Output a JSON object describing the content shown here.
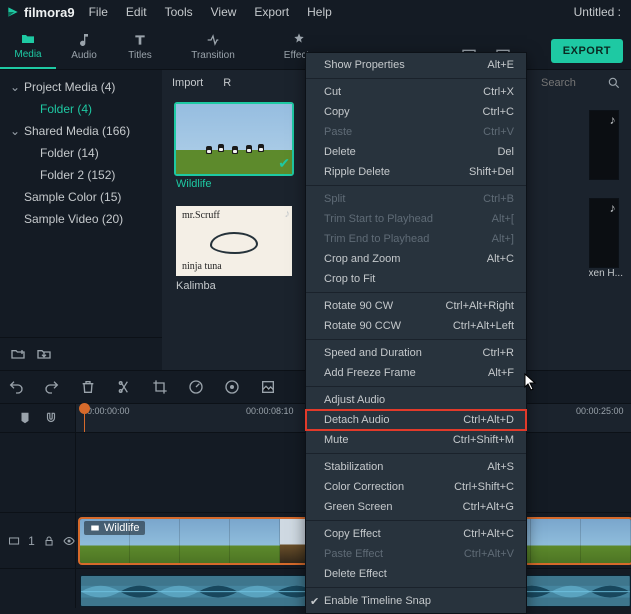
{
  "app": {
    "name": "filmora9",
    "window_title": "Untitled :"
  },
  "menubar": [
    "File",
    "Edit",
    "Tools",
    "View",
    "Export",
    "Help"
  ],
  "tabs": {
    "media": "Media",
    "audio": "Audio",
    "titles": "Titles",
    "transition": "Transition",
    "effects": "Effects"
  },
  "export_btn": "EXPORT",
  "content_header": {
    "import": "Import",
    "record_short": "R",
    "search_placeholder": "Search"
  },
  "sidebar": {
    "items": [
      {
        "label": "Project Media (4)",
        "indent": 0,
        "expandable": true,
        "selected": false
      },
      {
        "label": "Folder (4)",
        "indent": 1,
        "expandable": false,
        "selected": true
      },
      {
        "label": "Shared Media (166)",
        "indent": 0,
        "expandable": true,
        "selected": false
      },
      {
        "label": "Folder (14)",
        "indent": 1,
        "expandable": false,
        "selected": false
      },
      {
        "label": "Folder 2 (152)",
        "indent": 1,
        "expandable": false,
        "selected": false
      },
      {
        "label": "Sample Color (15)",
        "indent": 0,
        "expandable": false,
        "selected": false
      },
      {
        "label": "Sample Video (20)",
        "indent": 0,
        "expandable": false,
        "selected": false
      }
    ]
  },
  "thumbs": {
    "wildlife": "Wildlife",
    "kalimba": "Kalimba",
    "scruff_top": "mr.Scruff",
    "scruff_bot": "ninja tuna",
    "right1": "xen H..."
  },
  "timeline": {
    "timecodes": [
      "00:00:00:00",
      "00:00:08:10",
      "00:00:25:00"
    ],
    "clip_label": "Wildlife",
    "track_label": "1"
  },
  "ctx": {
    "items": [
      {
        "label": "Show Properties",
        "shortcut": "Alt+E",
        "enabled": true
      },
      {
        "sep": true
      },
      {
        "label": "Cut",
        "shortcut": "Ctrl+X",
        "enabled": true
      },
      {
        "label": "Copy",
        "shortcut": "Ctrl+C",
        "enabled": true
      },
      {
        "label": "Paste",
        "shortcut": "Ctrl+V",
        "enabled": false
      },
      {
        "label": "Delete",
        "shortcut": "Del",
        "enabled": true
      },
      {
        "label": "Ripple Delete",
        "shortcut": "Shift+Del",
        "enabled": true
      },
      {
        "sep": true
      },
      {
        "label": "Split",
        "shortcut": "Ctrl+B",
        "enabled": false
      },
      {
        "label": "Trim Start to Playhead",
        "shortcut": "Alt+[",
        "enabled": false
      },
      {
        "label": "Trim End to Playhead",
        "shortcut": "Alt+]",
        "enabled": false
      },
      {
        "label": "Crop and Zoom",
        "shortcut": "Alt+C",
        "enabled": true
      },
      {
        "label": "Crop to Fit",
        "shortcut": "",
        "enabled": true
      },
      {
        "sep": true
      },
      {
        "label": "Rotate 90 CW",
        "shortcut": "Ctrl+Alt+Right",
        "enabled": true
      },
      {
        "label": "Rotate 90 CCW",
        "shortcut": "Ctrl+Alt+Left",
        "enabled": true
      },
      {
        "sep": true
      },
      {
        "label": "Speed and Duration",
        "shortcut": "Ctrl+R",
        "enabled": true
      },
      {
        "label": "Add Freeze Frame",
        "shortcut": "Alt+F",
        "enabled": true
      },
      {
        "sep": true
      },
      {
        "label": "Adjust Audio",
        "shortcut": "",
        "enabled": true
      },
      {
        "label": "Detach Audio",
        "shortcut": "Ctrl+Alt+D",
        "enabled": true,
        "highlight": true
      },
      {
        "label": "Mute",
        "shortcut": "Ctrl+Shift+M",
        "enabled": true
      },
      {
        "sep": true
      },
      {
        "label": "Stabilization",
        "shortcut": "Alt+S",
        "enabled": true
      },
      {
        "label": "Color Correction",
        "shortcut": "Ctrl+Shift+C",
        "enabled": true
      },
      {
        "label": "Green Screen",
        "shortcut": "Ctrl+Alt+G",
        "enabled": true
      },
      {
        "sep": true
      },
      {
        "label": "Copy Effect",
        "shortcut": "Ctrl+Alt+C",
        "enabled": true
      },
      {
        "label": "Paste Effect",
        "shortcut": "Ctrl+Alt+V",
        "enabled": false
      },
      {
        "label": "Delete Effect",
        "shortcut": "",
        "enabled": true
      },
      {
        "sep": true
      },
      {
        "label": "Enable Timeline Snap",
        "shortcut": "",
        "enabled": true,
        "checked": true
      }
    ]
  }
}
